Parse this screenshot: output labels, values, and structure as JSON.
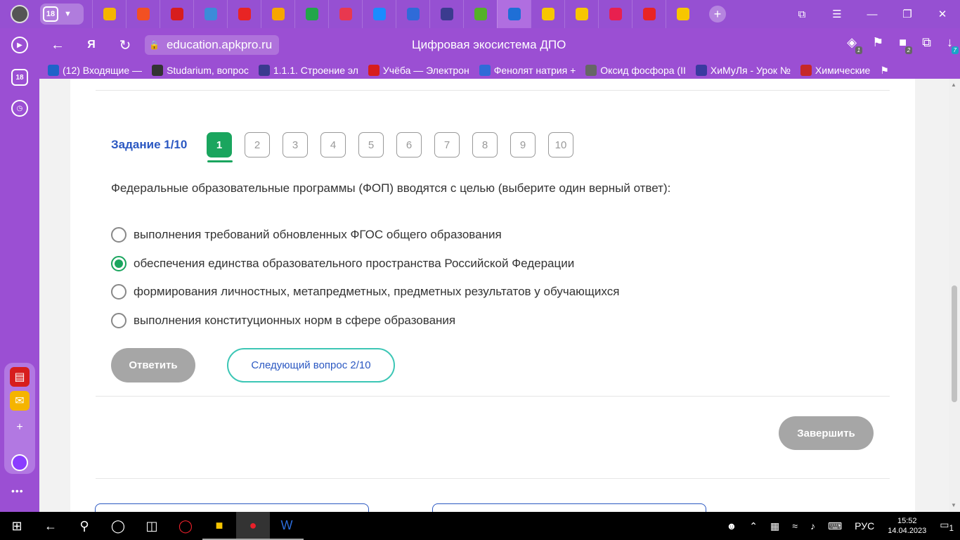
{
  "tabstrip": {
    "tab_count": "18",
    "tabs": [
      {
        "icon": "mail-icon",
        "color": "#f5b400"
      },
      {
        "icon": "microsoft-icon",
        "color": "#f25022"
      },
      {
        "icon": "doc-icon",
        "color": "#d71d1d"
      },
      {
        "icon": "edge-icon",
        "color": "#3c8bd9"
      },
      {
        "icon": "h-icon",
        "color": "#e82424"
      },
      {
        "icon": "b-icon",
        "color": "#f7a600"
      },
      {
        "icon": "three-e-icon",
        "color": "#22a64a"
      },
      {
        "icon": "k-icon",
        "color": "#e8384f"
      },
      {
        "icon": "chat-icon",
        "color": "#1a8cff"
      },
      {
        "icon": "a-icon",
        "color": "#2f6bd8"
      },
      {
        "icon": "app-icon",
        "color": "#3b3b8f"
      },
      {
        "icon": "book-icon",
        "color": "#54b028"
      },
      {
        "icon": "open-book-icon",
        "color": "#1f6fd6",
        "active": true
      },
      {
        "icon": "info-icon",
        "color": "#f7c600"
      },
      {
        "icon": "info-icon",
        "color": "#f7c600"
      },
      {
        "icon": "folder-icon",
        "color": "#e8204f"
      },
      {
        "icon": "yandex-icon",
        "color": "#e82424"
      },
      {
        "icon": "info-icon",
        "color": "#f7c600"
      }
    ]
  },
  "toolbar": {
    "url": "education.apkpro.ru",
    "page_title": "Цифровая экосистема ДПО",
    "badge_ext": "1",
    "badge_ext2": "2",
    "badge_downloads": "7"
  },
  "bookmarks": [
    {
      "label": "(12) Входящие — ",
      "color": "#1e63c9"
    },
    {
      "label": "Studarium, вопрос",
      "color": "#333333"
    },
    {
      "label": "1.1.1. Строение эл",
      "color": "#3a3a8f"
    },
    {
      "label": "Учёба — Электрон",
      "color": "#d71d1d"
    },
    {
      "label": "Фенолят натрия +",
      "color": "#2f6bd8"
    },
    {
      "label": "Оксид фосфора (II",
      "color": "#666666"
    },
    {
      "label": "ХиМуЛя - Урок №",
      "color": "#3a3aa0"
    },
    {
      "label": "Химические",
      "color": "#c62828"
    }
  ],
  "quiz": {
    "task_label": "Задание 1/10",
    "question_numbers": [
      "1",
      "2",
      "3",
      "4",
      "5",
      "6",
      "7",
      "8",
      "9",
      "10"
    ],
    "active_question": "1",
    "question": "Федеральные образовательные программы (ФОП) вводятся с целью (выберите один верный ответ):",
    "options": [
      {
        "text": "выполнения требований обновленных ФГОС общего образования",
        "checked": false
      },
      {
        "text": "обеспечения единства образовательного пространства Российской Федерации",
        "checked": true
      },
      {
        "text": "формирования личностных, метапредметных, предметных результатов у обучающихся",
        "checked": false
      },
      {
        "text": "выполнения конституционных норм в сфере образования",
        "checked": false
      }
    ],
    "answer_button": "Ответить",
    "next_button": "Следующий вопрос 2/10",
    "finish_button": "Завершить"
  },
  "taskbar": {
    "language": "РУС",
    "time": "15:52",
    "date": "14.04.2023",
    "notifications": "1"
  },
  "colors": {
    "browser_purple": "#9650d2",
    "accent_green": "#1aa55e",
    "link_blue": "#2b58c2",
    "outline_teal": "#3cc6b5"
  }
}
